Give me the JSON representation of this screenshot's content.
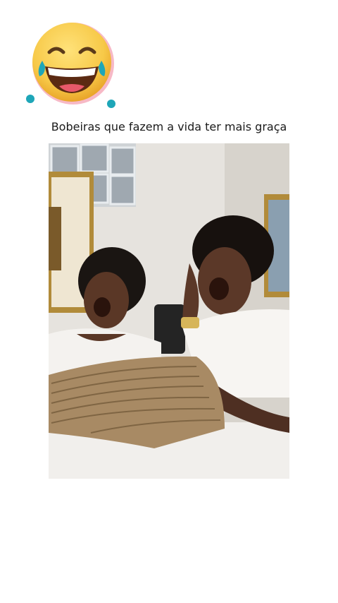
{
  "post": {
    "caption": "Bobeiras que fazem a vida ter mais graça"
  },
  "icons": {
    "sticker": "laughing-tears-emoji",
    "media": "video-frame"
  },
  "colors": {
    "background": "#ffffff",
    "emoji_face": "#f7c948",
    "tear": "#1ea6b8",
    "text": "#1a1a1a"
  }
}
